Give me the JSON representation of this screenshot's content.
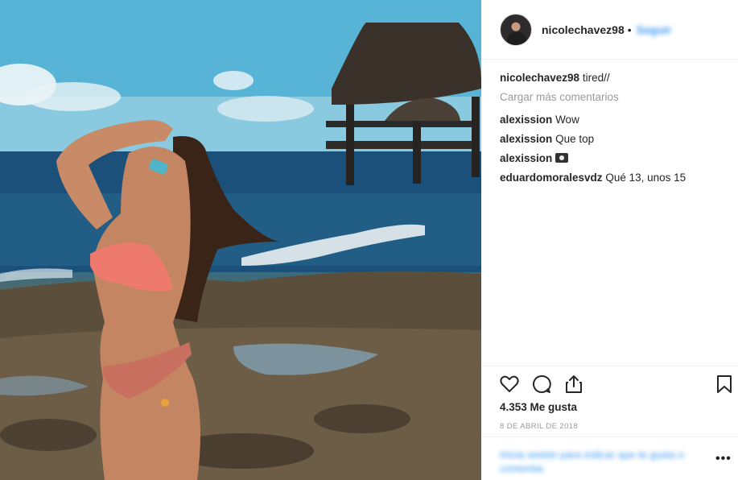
{
  "post": {
    "username": "nicolechavez98",
    "header_separator": "•",
    "follow_label": "Seguir",
    "caption": "tired//",
    "load_more": "Cargar más comentarios",
    "comments": [
      {
        "user": "alexission",
        "text": "Wow"
      },
      {
        "user": "alexission",
        "text": "Que top"
      },
      {
        "user": "alexission",
        "text": "",
        "icon": "camera-emoji"
      },
      {
        "user": "eduardomoralesvdz",
        "text": "Qué 13, unos 15"
      }
    ],
    "likes": "4.353 Me gusta",
    "date": "8 DE ABRIL DE 2018",
    "add_comment_placeholder": "Inicia sesión para indicar que te gusta o comentar.",
    "more_options": "•••"
  },
  "icons": {
    "like": "heart-icon",
    "comment": "comment-bubble-icon",
    "share": "share-icon",
    "save": "bookmark-icon"
  },
  "colors": {
    "link": "#3897f0",
    "muted": "#999999",
    "border": "#efefef"
  }
}
